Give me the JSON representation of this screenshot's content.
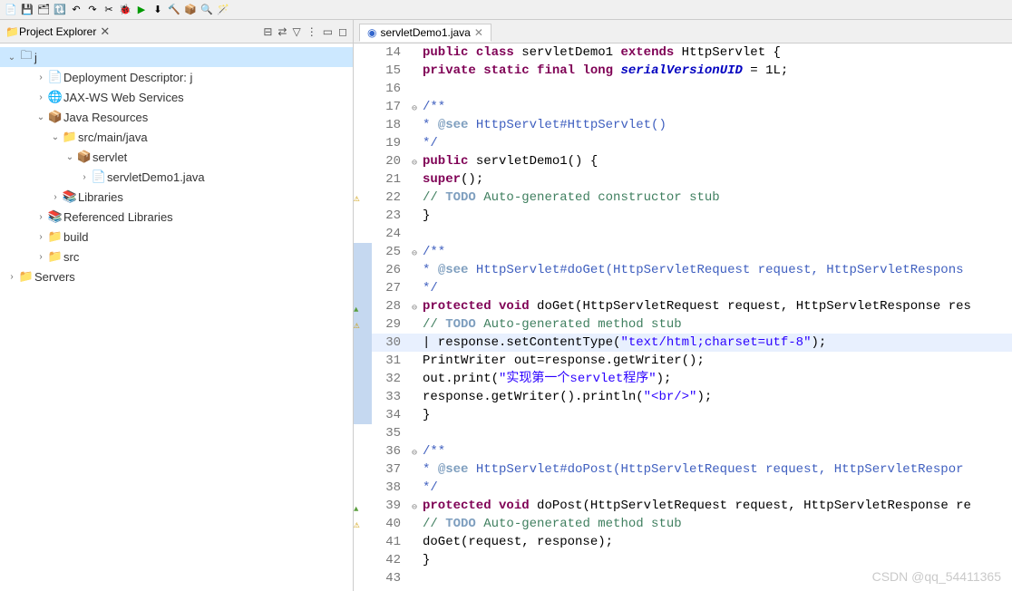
{
  "toolbar_title": "",
  "explorer": {
    "title": "Project Explorer",
    "root": {
      "label": "j"
    },
    "items": [
      {
        "label": "Deployment Descriptor: j",
        "icon": "📄",
        "depth": 2,
        "twisty": "›"
      },
      {
        "label": "JAX-WS Web Services",
        "icon": "🌐",
        "depth": 2,
        "twisty": "›"
      },
      {
        "label": "Java Resources",
        "icon": "📦",
        "depth": 2,
        "twisty": "⌄"
      },
      {
        "label": "src/main/java",
        "icon": "📁",
        "depth": 3,
        "twisty": "⌄"
      },
      {
        "label": "servlet",
        "icon": "📦",
        "depth": 4,
        "twisty": "⌄"
      },
      {
        "label": "servletDemo1.java",
        "icon": "📄",
        "depth": 5,
        "twisty": "›"
      },
      {
        "label": "Libraries",
        "icon": "📚",
        "depth": 3,
        "twisty": "›"
      },
      {
        "label": "Referenced Libraries",
        "icon": "📚",
        "depth": 2,
        "twisty": "›"
      },
      {
        "label": "build",
        "icon": "📁",
        "depth": 2,
        "twisty": "›"
      },
      {
        "label": "src",
        "icon": "📁",
        "depth": 2,
        "twisty": "›"
      }
    ],
    "servers": {
      "label": "Servers",
      "icon": "📁"
    }
  },
  "editor": {
    "tab_label": "servletDemo1.java",
    "lines": [
      {
        "n": 14
      },
      {
        "n": 15
      },
      {
        "n": 16
      },
      {
        "n": 17,
        "fold": true
      },
      {
        "n": 18
      },
      {
        "n": 19
      },
      {
        "n": 20,
        "fold": true
      },
      {
        "n": 21
      },
      {
        "n": 22,
        "warn": true
      },
      {
        "n": 23
      },
      {
        "n": 24
      },
      {
        "n": 25,
        "fold": true,
        "bar": true
      },
      {
        "n": 26,
        "bar": true
      },
      {
        "n": 27,
        "bar": true
      },
      {
        "n": 28,
        "fold": true,
        "bar": true,
        "up": true
      },
      {
        "n": 29,
        "warn": true,
        "bar": true
      },
      {
        "n": 30,
        "bar": true,
        "hl": true
      },
      {
        "n": 31,
        "bar": true
      },
      {
        "n": 32,
        "bar": true
      },
      {
        "n": 33,
        "bar": true
      },
      {
        "n": 34,
        "bar": true
      },
      {
        "n": 35
      },
      {
        "n": 36,
        "fold": true
      },
      {
        "n": 37
      },
      {
        "n": 38
      },
      {
        "n": 39,
        "fold": true,
        "up": true
      },
      {
        "n": 40,
        "warn": true
      },
      {
        "n": 41
      },
      {
        "n": 42
      },
      {
        "n": 43
      }
    ]
  },
  "watermark": "CSDN @qq_54411365"
}
